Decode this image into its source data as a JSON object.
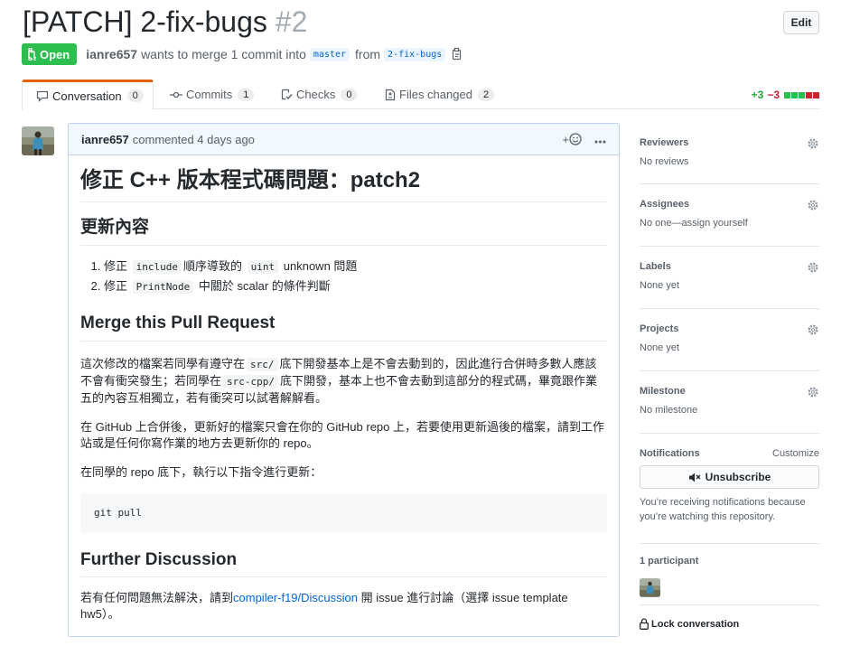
{
  "header": {
    "title": "[PATCH] 2-fix-bugs",
    "number": "#2",
    "edit_label": "Edit",
    "state_label": "Open",
    "author": "ianre657",
    "merge_text": "wants to merge 1 commit into",
    "base_branch": "master",
    "from_text": "from",
    "head_branch": "2-fix-bugs"
  },
  "tabs": [
    {
      "label": "Conversation",
      "count": "0",
      "icon": "comment-icon"
    },
    {
      "label": "Commits",
      "count": "1",
      "icon": "commit-icon"
    },
    {
      "label": "Checks",
      "count": "0",
      "icon": "checklist-icon"
    },
    {
      "label": "Files changed",
      "count": "2",
      "icon": "file-diff-icon"
    }
  ],
  "diffstat": {
    "additions": "+3",
    "deletions": "−3",
    "blocks": [
      "#2cbe4e",
      "#2cbe4e",
      "#2cbe4e",
      "#cb2431",
      "#cb2431"
    ]
  },
  "comment": {
    "author": "ianre657",
    "action_time": "commented 4 days ago",
    "reaction_label": "+",
    "h1": "修正 C++ 版本程式碼問題：patch2",
    "section1_title": "更新內容",
    "item1": {
      "prefix": "修正",
      "code1": "include",
      "middle": "順序導致的",
      "code2": "uint",
      "suffix": "unknown 問題"
    },
    "item2": {
      "prefix": "修正",
      "code": "PrintNode",
      "suffix": "中關於 scalar 的條件判斷"
    },
    "section2_title": "Merge this Pull Request",
    "para1": {
      "a": "這次修改的檔案若同學有遵守在",
      "code1": "src/",
      "b": "底下開發基本上是不會去動到的，因此進行合併時多數人應該不會有衝突發生；若同學在",
      "code2": "src-cpp/",
      "c": "底下開發，基本上也不會去動到這部分的程式碼，畢竟跟作業五的內容互相獨立，若有衝突可以試著解解看。"
    },
    "para2": "在 GitHub 上合併後，更新好的檔案只會在你的 GitHub repo 上，若要使用更新過後的檔案，請到工作站或是任何你寫作業的地方去更新你的 repo。",
    "para3": "在同學的 repo 底下，執行以下指令進行更新：",
    "code_block": "git pull",
    "section3_title": "Further Discussion",
    "para4": {
      "a": "若有任何問題無法解決，請到",
      "link": "compiler-f19/Discussion",
      "b": "開 issue 進行討論（選擇 issue template",
      "c": "hw5）。"
    }
  },
  "sidebar": {
    "reviewers": {
      "title": "Reviewers",
      "value": "No reviews"
    },
    "assignees": {
      "title": "Assignees",
      "value": "No one—assign yourself"
    },
    "labels": {
      "title": "Labels",
      "value": "None yet"
    },
    "projects": {
      "title": "Projects",
      "value": "None yet"
    },
    "milestone": {
      "title": "Milestone",
      "value": "No milestone"
    },
    "notifications": {
      "title": "Notifications",
      "customize": "Customize",
      "button": "Unsubscribe",
      "text": "You’re receiving notifications because you’re watching this repository."
    },
    "participants": {
      "title": "1 participant"
    },
    "lock_label": "Lock conversation"
  }
}
